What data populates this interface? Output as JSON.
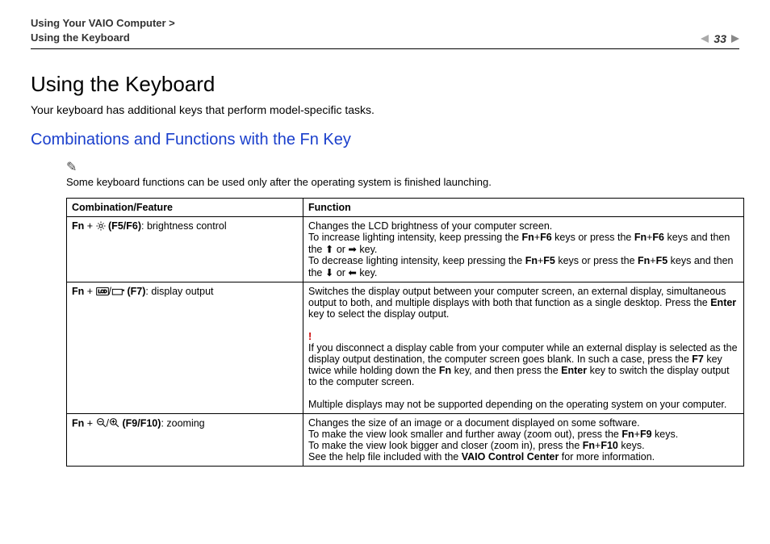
{
  "header": {
    "breadcrumb_line1": "Using Your VAIO Computer >",
    "breadcrumb_line2": "Using the Keyboard",
    "page_number": "33"
  },
  "title": "Using the Keyboard",
  "intro": "Your keyboard has additional keys that perform model-specific tasks.",
  "section_title": "Combinations and Functions with the Fn Key",
  "note": "Some keyboard functions can be used only after the operating system is finished launching.",
  "table": {
    "head_combo": "Combination/Feature",
    "head_func": "Function",
    "rows": [
      {
        "combo_prefix": "Fn",
        "combo_keys": "(F5/F6)",
        "combo_suffix": ": brightness control",
        "icon": "brightness",
        "func_line1": "Changes the LCD brightness of your computer screen.",
        "func_inc_a": "To increase lighting intensity, keep pressing the ",
        "func_inc_k1": "Fn",
        "func_inc_plus1": "+",
        "func_inc_k2": "F6",
        "func_inc_b": " keys or press the ",
        "func_inc_k3": "Fn",
        "func_inc_plus2": "+",
        "func_inc_k4": "F6",
        "func_inc_c": " keys and then the ",
        "func_inc_or": " or ",
        "func_inc_d": " key.",
        "func_dec_a": "To decrease lighting intensity, keep pressing the ",
        "func_dec_k1": "Fn",
        "func_dec_plus1": "+",
        "func_dec_k2": "F5",
        "func_dec_b": " keys or press the ",
        "func_dec_k3": "Fn",
        "func_dec_plus2": "+",
        "func_dec_k4": "F5",
        "func_dec_c": " keys and then the ",
        "func_dec_or": " or ",
        "func_dec_d": " key."
      },
      {
        "combo_prefix": "Fn",
        "combo_keys": "(F7)",
        "combo_suffix": ": display output",
        "icon": "display",
        "func_p1_a": "Switches the display output between your computer screen, an external display, simultaneous output to both, and multiple displays with both that function as a single desktop. Press the ",
        "func_p1_enter": "Enter",
        "func_p1_b": " key to select the display output.",
        "warn_a": "If you disconnect a display cable from your computer while an external display is selected as the display output destination, the computer screen goes blank. In such a case, press the ",
        "warn_k1": "F7",
        "warn_b": " key twice while holding down the ",
        "warn_k2": "Fn",
        "warn_c": " key, and then press the ",
        "warn_k3": "Enter",
        "warn_d": " key to switch the display output to the computer screen.",
        "func_p3": "Multiple displays may not be supported depending on the operating system on your computer."
      },
      {
        "combo_prefix": "Fn",
        "combo_keys": "(F9/F10)",
        "combo_suffix": ": zooming",
        "icon": "zoom",
        "func_l1": "Changes the size of an image or a document displayed on some software.",
        "func_l2_a": "To make the view look smaller and further away (zoom out), press the ",
        "func_l2_k": "Fn",
        "func_l2_plus": "+",
        "func_l2_k2": "F9",
        "func_l2_b": " keys.",
        "func_l3_a": "To make the view look bigger and closer (zoom in), press the ",
        "func_l3_k": "Fn",
        "func_l3_plus": "+",
        "func_l3_k2": "F10",
        "func_l3_b": " keys.",
        "func_l4_a": "See the help file included with the ",
        "func_l4_k": "VAIO Control Center",
        "func_l4_b": " for more information."
      }
    ]
  }
}
